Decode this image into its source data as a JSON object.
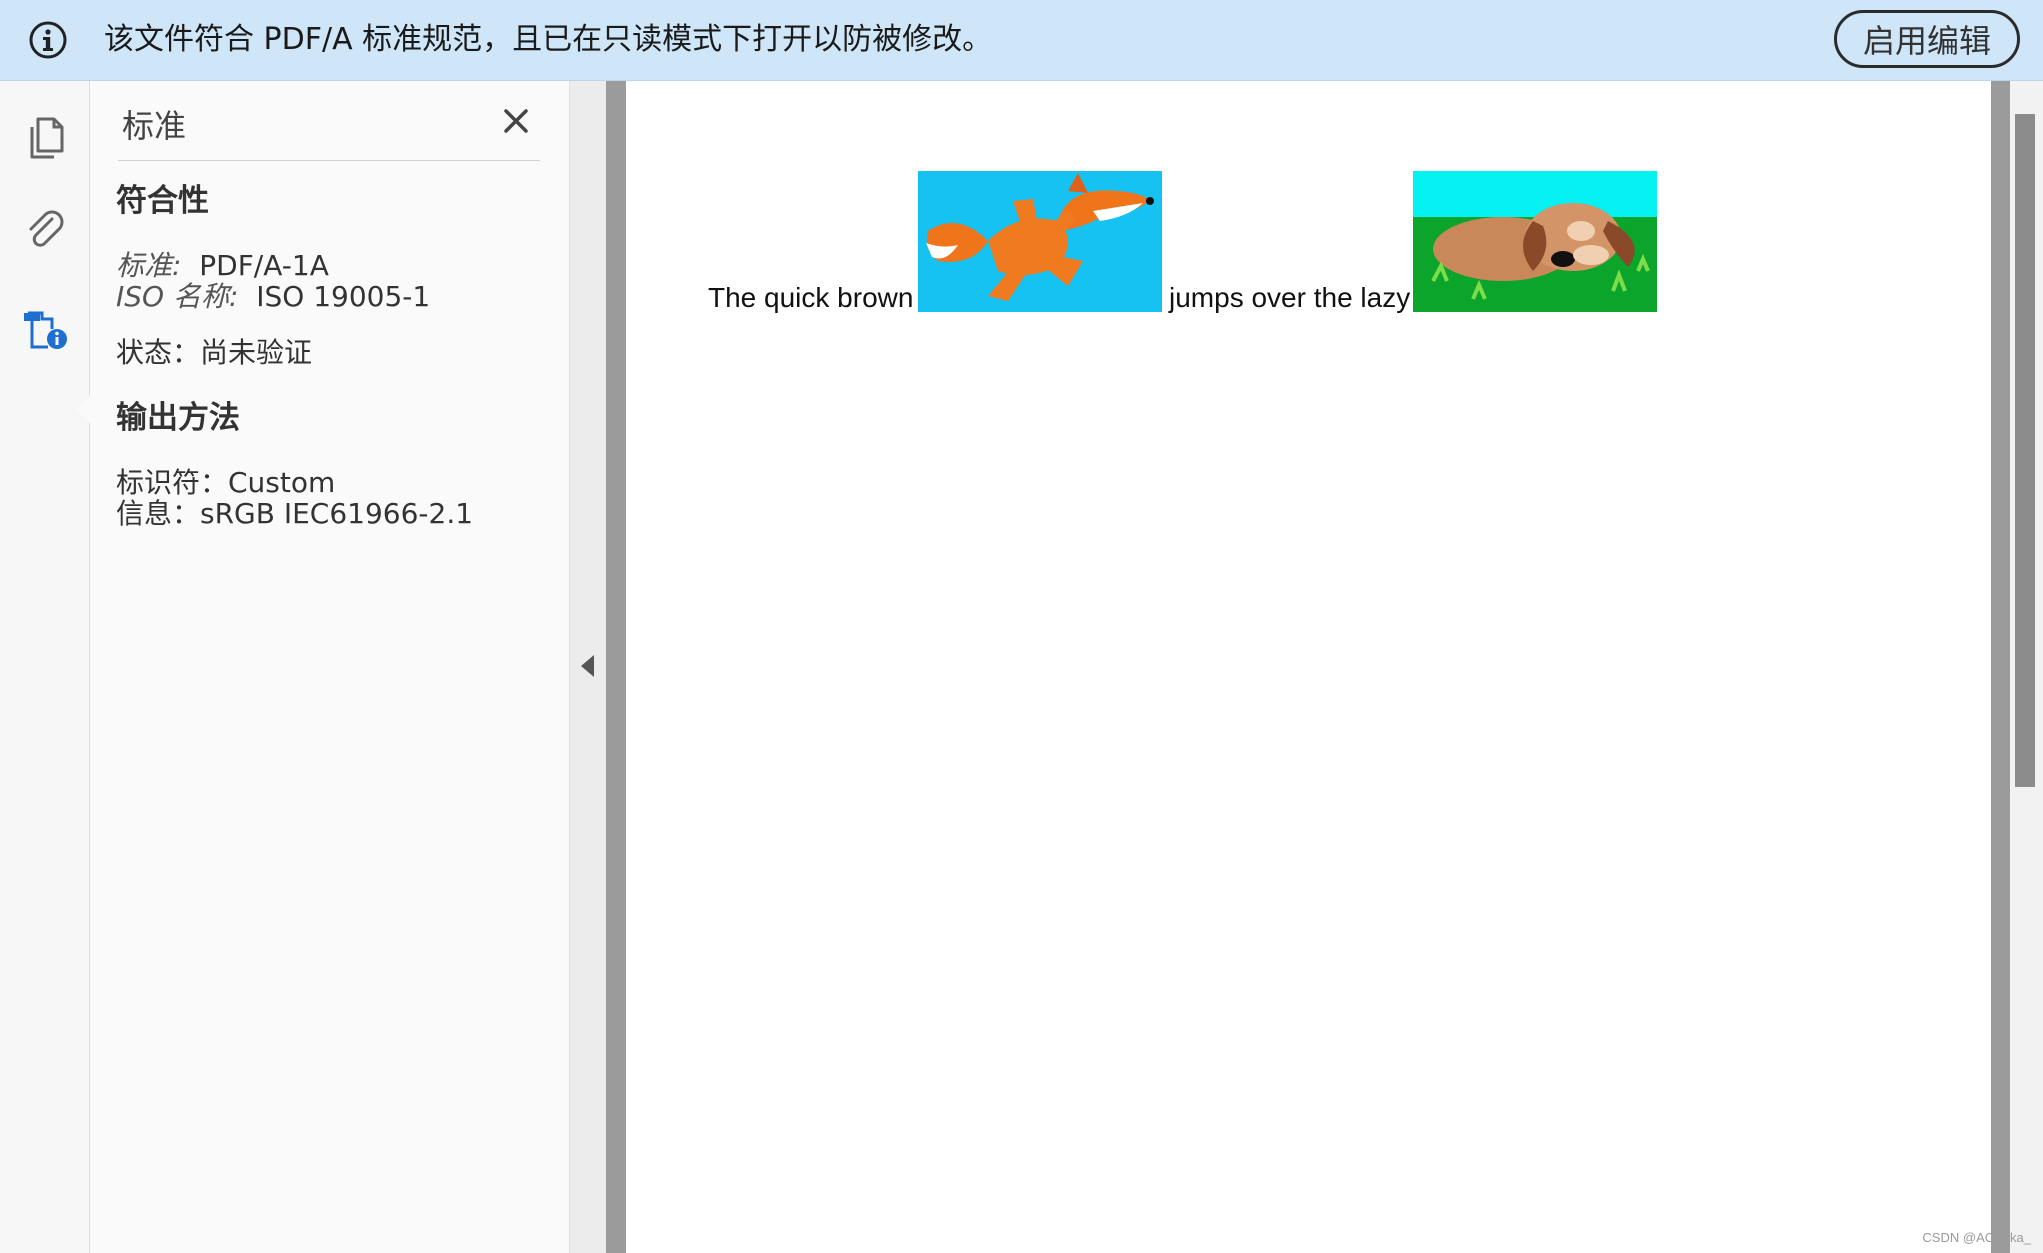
{
  "info_bar": {
    "message": "该文件符合 PDF/A 标准规范，且已在只读模式下打开以防被修改。",
    "enable_edit_label": "启用编辑",
    "icon": "info-circle-icon"
  },
  "rail": {
    "items": [
      {
        "name": "pages-thumbnails",
        "icon": "copy-pages-icon"
      },
      {
        "name": "attachments",
        "icon": "paperclip-icon"
      },
      {
        "name": "standards",
        "icon": "document-info-icon",
        "active": true
      }
    ]
  },
  "panel": {
    "title": "标准",
    "close_icon": "close-icon",
    "conformance": {
      "heading": "符合性",
      "standard_key": "标准:",
      "standard_value": "PDF/A-1A",
      "iso_key": "ISO 名称:",
      "iso_value": "ISO 19005-1",
      "status": "状态：尚未验证"
    },
    "output_intent": {
      "heading": "输出方法",
      "identifier": "标识符：Custom",
      "info": "信息：sRGB IEC61966-2.1"
    }
  },
  "document": {
    "text_1": "The quick brown",
    "image_1": "fox-running-image",
    "text_2": "jumps over the lazy",
    "image_2": "dog-lying-image"
  },
  "colors": {
    "info_bar_bg": "#cfe6f8",
    "accent_blue": "#1e6fd0"
  },
  "watermark": "CSDN @ACKaka_"
}
